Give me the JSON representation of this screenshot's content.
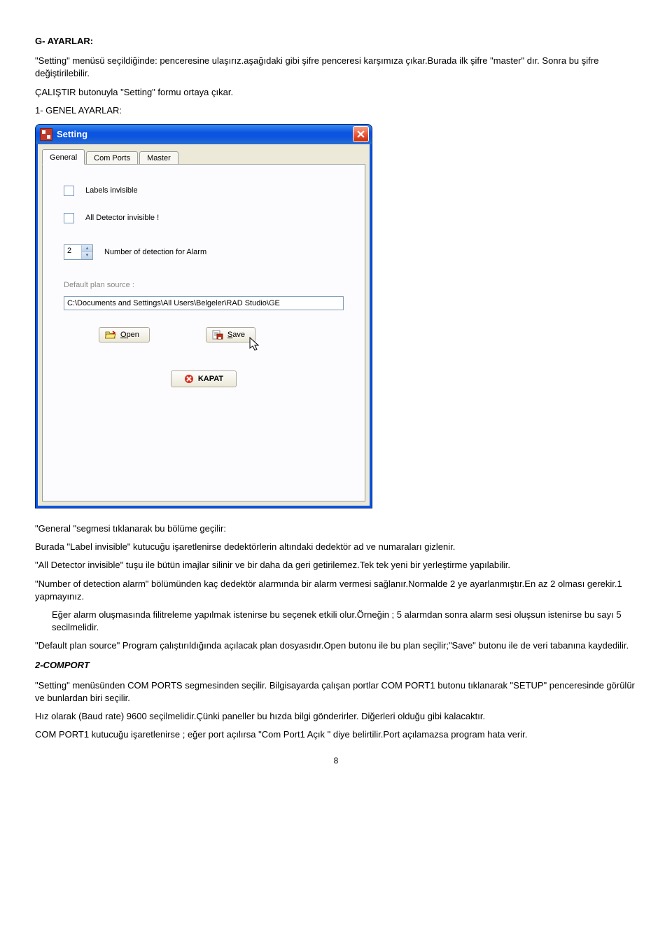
{
  "doc": {
    "h1": "G- AYARLAR:",
    "p1": "\"Setting\" menüsü seçildiğinde: penceresine ulaşırız.aşağıdaki gibi şifre penceresi karşımıza çıkar.Burada ilk şifre \"master\" dır. Sonra bu şifre değiştirilebilir.",
    "p2": "ÇALIŞTIR butonuyla \"Setting\" formu ortaya çıkar.",
    "h2": "1-  GENEL AYARLAR:",
    "p3a": "\"General \"segmesi tıklanarak bu bölüme geçilir:",
    "p3b": "Burada \"Label invisible\" kutucuğu işaretlenirse dedektörlerin altındaki dedektör ad ve numaraları gizlenir.",
    "p4": "\"All Detector invisible\" tuşu ile bütün imajlar silinir ve bir daha da geri getirilemez.Tek tek yeni bir yerleştirme yapılabilir.",
    "p5": "\"Number of detection alarm\" bölümünden kaç dedektör alarmında bir alarm vermesi sağlanır.Normalde 2 ye ayarlanmıştır.En az 2 olması gerekir.1 yapmayınız.",
    "p6": "Eğer alarm oluşmasında  filitreleme yapılmak istenirse bu seçenek etkili olur.Örneğin ; 5 alarmdan sonra alarm sesi oluşsun istenirse bu sayı 5 secilmelidir.",
    "p7": "\"Default plan source\" Program çalıştırıldığında açılacak plan dosyasıdır.Open butonu ile bu plan seçilir;\"Save\" butonu ile de veri tabanına kaydedilir.",
    "h3": "2-COMPORT",
    "p8": "\"Setting\" menüsünden COM PORTS segmesinden seçilir. Bilgisayarda çalışan portlar COM PORT1 butonu tıklanarak \"SETUP\" penceresinde görülür ve bunlardan biri seçilir.",
    "p9": "Hız olarak (Baud rate) 9600 seçilmelidir.Çünki paneller bu hızda bilgi gönderirler. Diğerleri olduğu gibi kalacaktır.",
    "p10": "COM PORT1 kutucuğu işaretlenirse ; eğer port açılırsa \"Com Port1 Açık \" diye belirtilir.Port açılamazsa program hata verir.",
    "pagenum": "8"
  },
  "window": {
    "title": "Setting",
    "tabs": {
      "general": "General",
      "comports": "Com Ports",
      "master": "Master"
    },
    "labels_invisible": "Labels invisible",
    "all_detector_invisible": "All Detector invisible !",
    "number_detection": "Number of detection  for Alarm",
    "spin_value": "2",
    "default_plan_source": "Default plan source :",
    "path_value": "C:\\Documents and Settings\\All Users\\Belgeler\\RAD Studio\\GE",
    "open_btn": "Open",
    "save_btn": "Save",
    "kapat_btn": "KAPAT"
  }
}
